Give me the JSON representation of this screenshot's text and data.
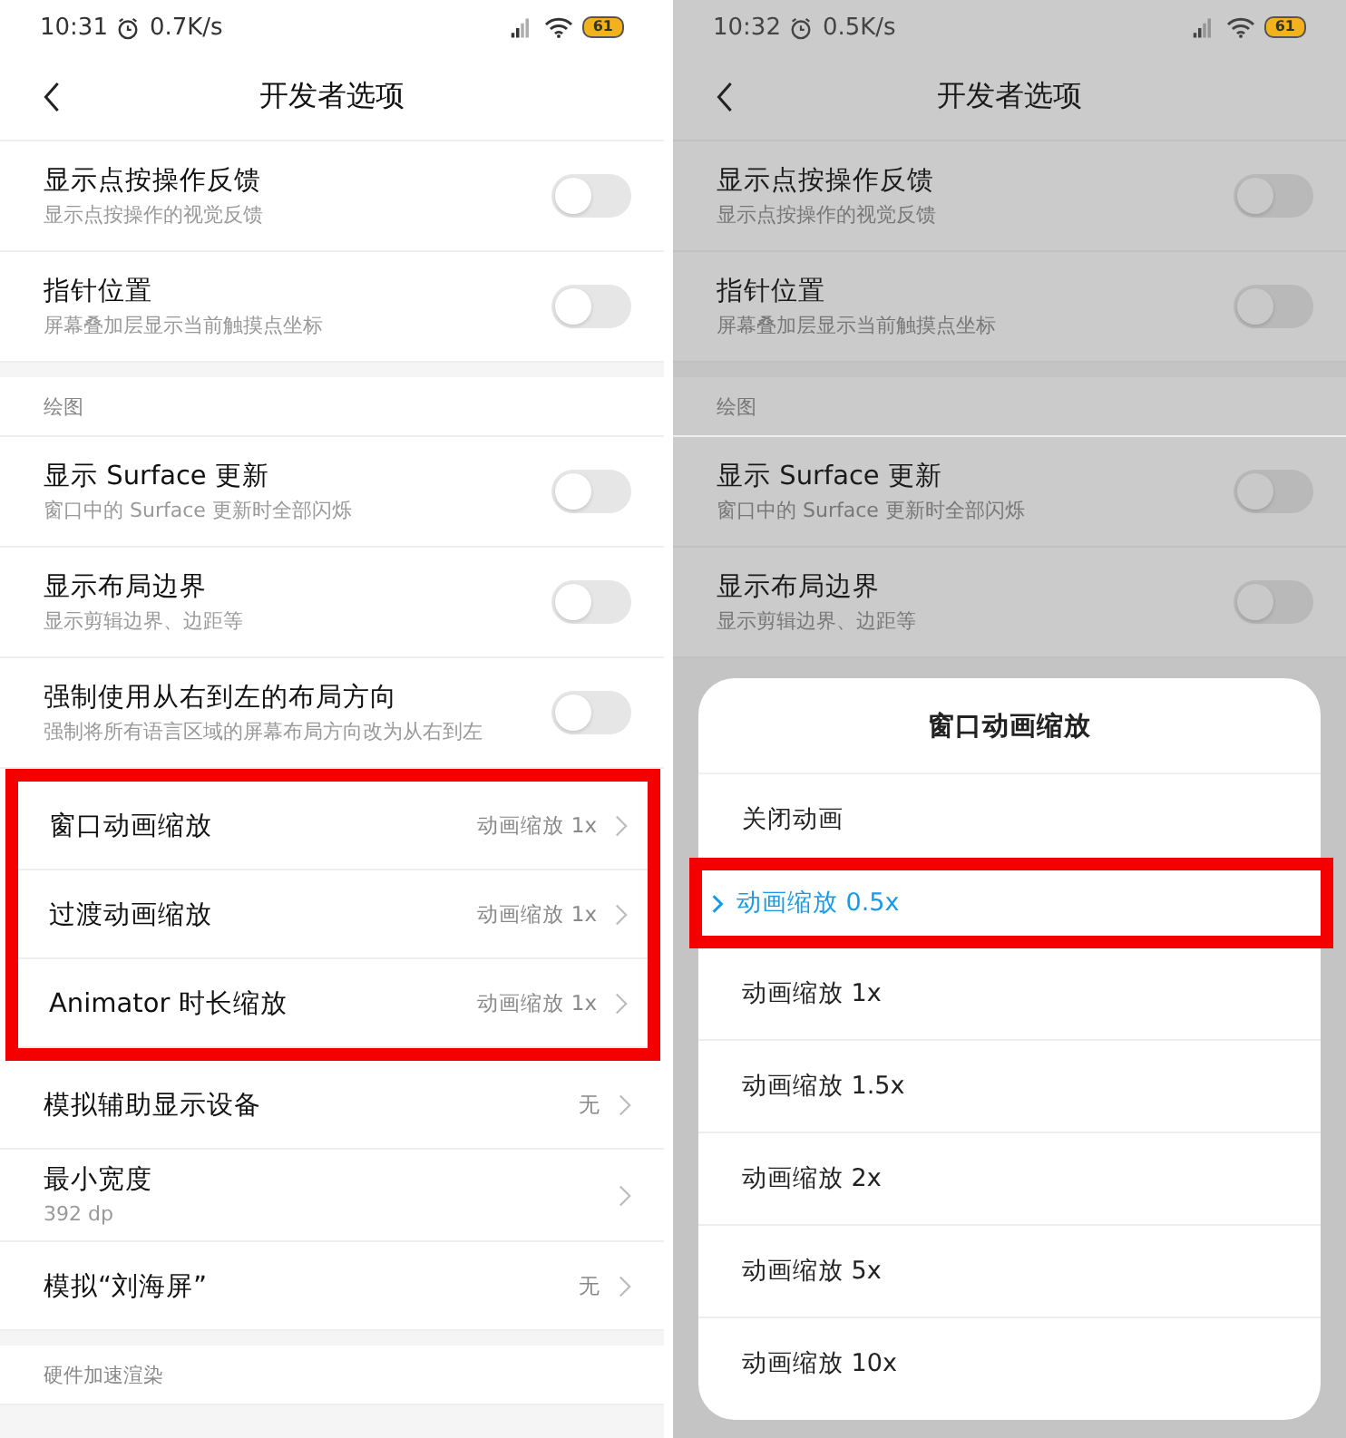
{
  "screens": [
    {
      "dimmed": false,
      "status_bar": {
        "time": "10:31",
        "speed": "0.7K/s",
        "battery": "61"
      },
      "header": {
        "title": "开发者选项"
      },
      "sections": [
        {
          "rows": [
            {
              "kind": "toggle",
              "title": "显示点按操作反馈",
              "subtitle": "显示点按操作的视觉反馈",
              "on": false,
              "highlighted": false
            },
            {
              "kind": "toggle",
              "title": "指针位置",
              "subtitle": "屏幕叠加层显示当前触摸点坐标",
              "on": false,
              "highlighted": false
            }
          ]
        },
        {
          "header": "绘图",
          "rows": [
            {
              "kind": "toggle",
              "title": "显示 Surface 更新",
              "subtitle": "窗口中的 Surface 更新时全部闪烁",
              "on": false,
              "highlighted": false
            },
            {
              "kind": "toggle",
              "title": "显示布局边界",
              "subtitle": "显示剪辑边界、边距等",
              "on": false,
              "highlighted": false
            },
            {
              "kind": "toggle",
              "title": "强制使用从右到左的布局方向",
              "subtitle": "强制将所有语言区域的屏幕布局方向改为从右到左",
              "on": false,
              "highlighted": false
            },
            {
              "kind": "link",
              "title": "窗口动画缩放",
              "value": "动画缩放 1x",
              "highlighted": true
            },
            {
              "kind": "link",
              "title": "过渡动画缩放",
              "value": "动画缩放 1x",
              "highlighted": true
            },
            {
              "kind": "link",
              "title": "Animator 时长缩放",
              "value": "动画缩放 1x",
              "highlighted": true
            },
            {
              "kind": "link",
              "title": "模拟辅助显示设备",
              "value": "无",
              "highlighted": false
            },
            {
              "kind": "link",
              "title": "最小宽度",
              "subtitle": "392 dp",
              "highlighted": false
            },
            {
              "kind": "link",
              "title": "模拟“刘海屏”",
              "value": "无",
              "highlighted": false
            }
          ]
        },
        {
          "header": "硬件加速渲染"
        }
      ]
    },
    {
      "dimmed": true,
      "status_bar": {
        "time": "10:32",
        "speed": "0.5K/s",
        "battery": "61"
      },
      "header": {
        "title": "开发者选项"
      },
      "sections": [
        {
          "rows": [
            {
              "kind": "toggle",
              "title": "显示点按操作反馈",
              "subtitle": "显示点按操作的视觉反馈",
              "on": false,
              "highlighted": false
            },
            {
              "kind": "toggle",
              "title": "指针位置",
              "subtitle": "屏幕叠加层显示当前触摸点坐标",
              "on": false,
              "highlighted": false
            }
          ]
        },
        {
          "header": "绘图",
          "rows": [
            {
              "kind": "toggle",
              "title": "显示 Surface 更新",
              "subtitle": "窗口中的 Surface 更新时全部闪烁",
              "on": false,
              "highlighted": false
            },
            {
              "kind": "toggle",
              "title": "显示布局边界",
              "subtitle": "显示剪辑边界、边距等",
              "on": false,
              "highlighted": false
            }
          ]
        }
      ],
      "dialog": {
        "title": "窗口动画缩放",
        "options": [
          {
            "label": "关闭动画",
            "selected": false,
            "highlighted": false
          },
          {
            "label": "动画缩放 0.5x",
            "selected": true,
            "highlighted": true
          },
          {
            "label": "动画缩放 1x",
            "selected": false,
            "highlighted": false
          },
          {
            "label": "动画缩放 1.5x",
            "selected": false,
            "highlighted": false
          },
          {
            "label": "动画缩放 2x",
            "selected": false,
            "highlighted": false
          },
          {
            "label": "动画缩放 5x",
            "selected": false,
            "highlighted": false
          },
          {
            "label": "动画缩放 10x",
            "selected": false,
            "highlighted": false
          }
        ]
      }
    }
  ]
}
